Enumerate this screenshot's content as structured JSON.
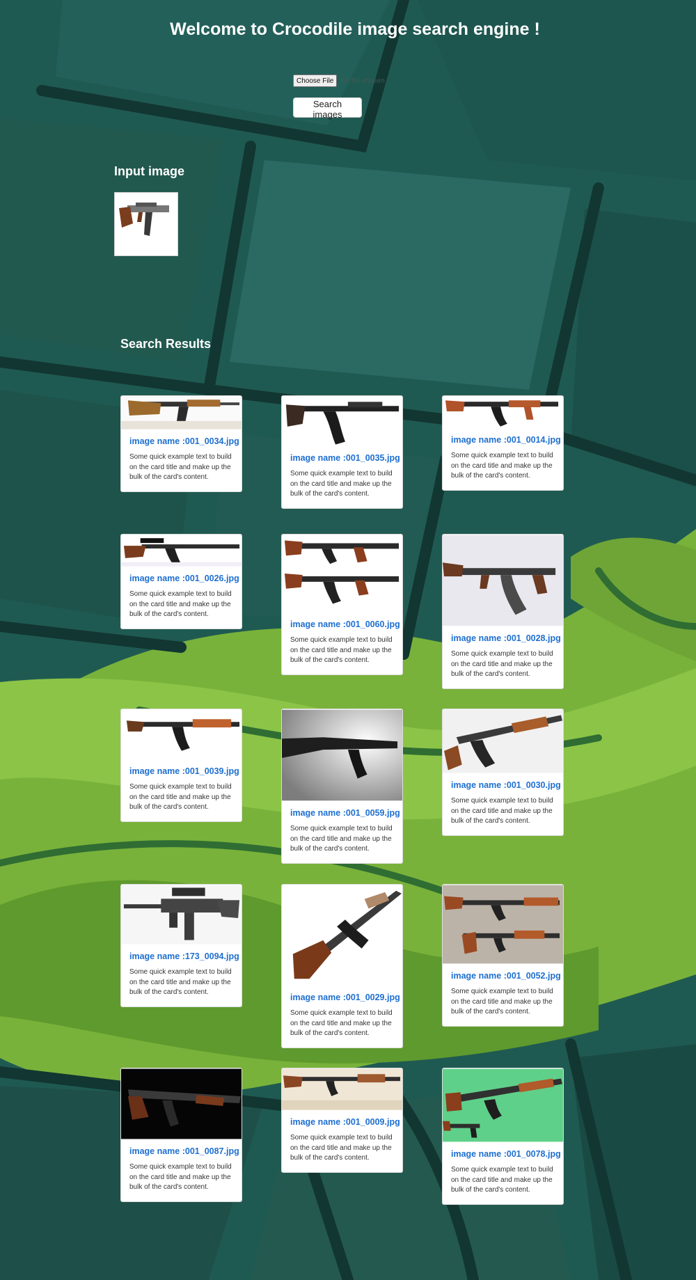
{
  "header": {
    "title": "Welcome to Crocodile image search engine !"
  },
  "upload": {
    "choose_label": "Choose File",
    "no_file_text": "No file chosen",
    "search_label": "Search images"
  },
  "input_section": {
    "heading": "Input image"
  },
  "results_section": {
    "heading": "Search Results",
    "cards": [
      {
        "title": "image name :001_0034.jpg",
        "text": "Some quick example text to build on the card title and make up the bulk of the card's content."
      },
      {
        "title": "image name :001_0035.jpg",
        "text": "Some quick example text to build on the card title and make up the bulk of the card's content."
      },
      {
        "title": "image name :001_0014.jpg",
        "text": "Some quick example text to build on the card title and make up the bulk of the card's content."
      },
      {
        "title": "image name :001_0026.jpg",
        "text": "Some quick example text to build on the card title and make up the bulk of the card's content."
      },
      {
        "title": "image name :001_0060.jpg",
        "text": "Some quick example text to build on the card title and make up the bulk of the card's content."
      },
      {
        "title": "image name :001_0028.jpg",
        "text": "Some quick example text to build on the card title and make up the bulk of the card's content."
      },
      {
        "title": "image name :001_0039.jpg",
        "text": "Some quick example text to build on the card title and make up the bulk of the card's content."
      },
      {
        "title": "image name :001_0059.jpg",
        "text": "Some quick example text to build on the card title and make up the bulk of the card's content."
      },
      {
        "title": "image name :001_0030.jpg",
        "text": "Some quick example text to build on the card title and make up the bulk of the card's content."
      },
      {
        "title": "image name :173_0094.jpg",
        "text": "Some quick example text to build on the card title and make up the bulk of the card's content."
      },
      {
        "title": "image name :001_0029.jpg",
        "text": "Some quick example text to build on the card title and make up the bulk of the card's content."
      },
      {
        "title": "image name :001_0052.jpg",
        "text": "Some quick example text to build on the card title and make up the bulk of the card's content."
      },
      {
        "title": "image name :001_0087.jpg",
        "text": "Some quick example text to build on the card title and make up the bulk of the card's content."
      },
      {
        "title": "image name :001_0009.jpg",
        "text": "Some quick example text to build on the card title and make up the bulk of the card's content."
      },
      {
        "title": "image name :001_0078.jpg",
        "text": "Some quick example text to build on the card title and make up the bulk of the card's content."
      }
    ]
  },
  "colors": {
    "link_title": "#1e6fd0",
    "background_dark": "#1c4d47",
    "background_leaf": "#7fb53d"
  }
}
